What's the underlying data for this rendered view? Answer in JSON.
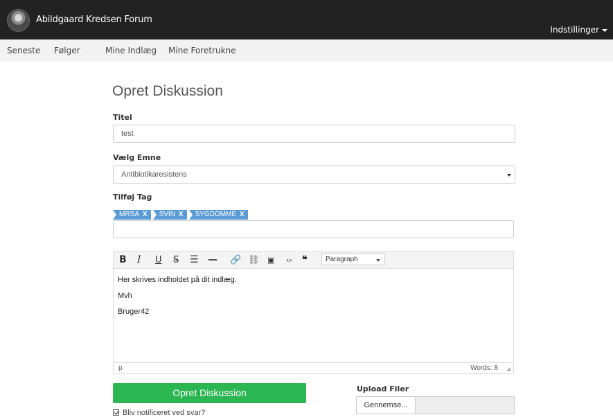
{
  "header": {
    "brand": "Abildgaard Kredsen Forum",
    "settings_label": "Indstillinger"
  },
  "subnav": {
    "items": [
      "Seneste",
      "Følger",
      "Mine Indlæg",
      "Mine Foretrukne"
    ]
  },
  "form": {
    "page_title": "Opret Diskussion",
    "title_label": "Titel",
    "title_value": "test",
    "topic_label": "Vælg Emne",
    "topic_value": "Antibiotikaresistens",
    "tag_label": "Tilføj Tag",
    "tags": [
      "MRSA",
      "SVIN",
      "SYGDOMME"
    ],
    "tag_remove": "X",
    "tag_input_value": ""
  },
  "editor": {
    "paragraph_format": "Paragraph",
    "lines": [
      "Her skrives indholdet på dit indlæg.",
      "Mvh",
      "Bruger42"
    ],
    "path": "p",
    "word_count": "Words: 8",
    "icons": [
      "bold-icon",
      "italic-icon",
      "underline-icon",
      "strikethrough-icon",
      "bullet-list-icon",
      "horizontal-rule-icon",
      "link-icon",
      "unlink-icon",
      "image-icon",
      "code-icon",
      "blockquote-icon"
    ]
  },
  "actions": {
    "submit_label": "Opret Diskussion",
    "notify_label": "Bliv notificeret ved svar?",
    "notify_checked": true,
    "upload_label": "Upload Filer",
    "browse_label": "Gennemse..."
  },
  "colors": {
    "navbar": "#222222",
    "subnav": "#f2f2f2",
    "tag": "#5b9bd5",
    "submit": "#2cb652"
  }
}
